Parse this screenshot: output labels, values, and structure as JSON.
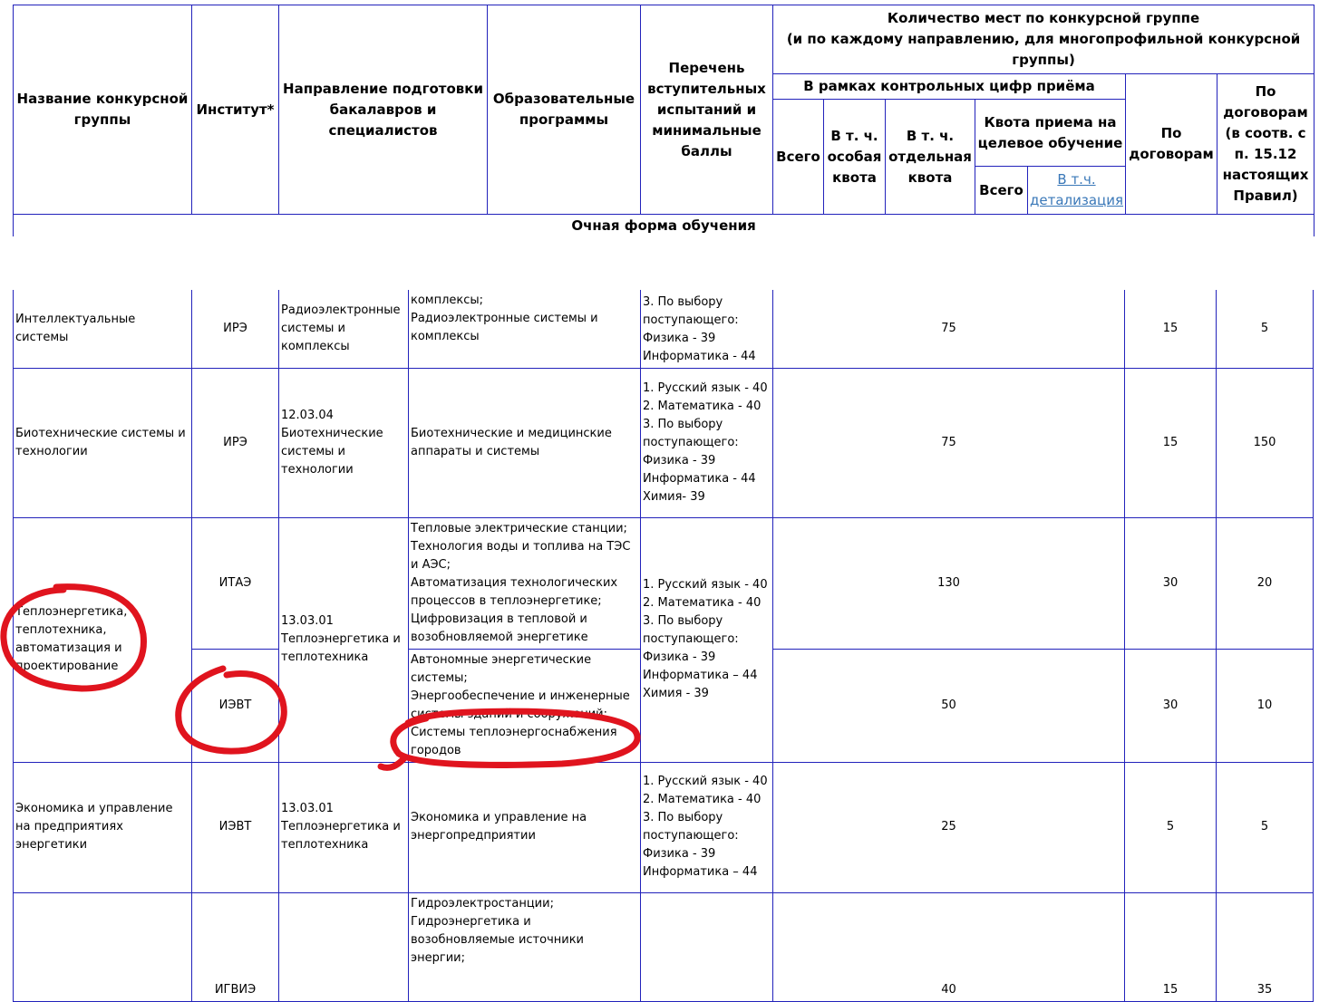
{
  "header": {
    "col_name": "Название конкурсной группы",
    "col_institute": "Институт*",
    "col_direction": "Направление подготовки бакалавров и специалистов",
    "col_programs": "Образовательные программы",
    "col_exams": "Перечень вступительных испытаний и минимальные баллы",
    "col_places": "Количество мест по конкурсной группе\n(и по каждому направлению, для многопрофильной конкурсной группы)",
    "col_control": "В рамках контрольных цифр приёма",
    "col_total": "Всего",
    "col_special": "В т. ч. особая квота",
    "col_separate": "В т. ч. отдельная квота",
    "col_target": "Квота приема на целевое обучение",
    "col_target_total": "Всего",
    "col_target_detail": "В т.ч. детализация",
    "col_contract": "По договорам",
    "col_contract_1512": "По договорам (в соотв. с п. 15.12 настоящих Правил)",
    "section_title": "Очная форма обучения"
  },
  "rows": {
    "r1": {
      "name": "Интеллектуальные системы",
      "institute": "ИРЭ",
      "direction": "Радиоэлектронные системы и комплексы",
      "programs": "комплексы;\nРадиоэлектронные системы и комплексы",
      "exams": "3. По выбору поступающего:\nФизика - 39\nИнформатика - 44",
      "total": "75",
      "contract": "15",
      "contract_1512": "5"
    },
    "r2": {
      "name": "Биотехнические системы и технологии",
      "institute": "ИРЭ",
      "direction": "12.03.04\nБиотехнические системы и технологии",
      "programs": "Биотехнические и медицинские аппараты и системы",
      "exams": "1. Русский язык - 40\n2. Математика - 40\n3. По выбору поступающего:\nФизика - 39\nИнформатика - 44\nХимия- 39",
      "total": "75",
      "contract": "15",
      "contract_1512": "150"
    },
    "r3": {
      "name": "Теплоэнергетика, теплотехника, автоматизация и проектирование",
      "direction": "13.03.01\nТеплоэнергетика и теплотехника",
      "exams": "1. Русский язык - 40\n2. Математика - 40\n3. По выбору поступающего:\nФизика - 39\nИнформатика – 44\nХимия - 39",
      "a": {
        "institute": "ИТАЭ",
        "programs": "Тепловые электрические станции;\nТехнология воды и топлива на ТЭС и АЭС;\nАвтоматизация технологических процессов в теплоэнергетике;\nЦифровизация в тепловой и возобновляемой энергетике",
        "total": "130",
        "contract": "30",
        "contract_1512": "20"
      },
      "b": {
        "institute": "ИЭВТ",
        "programs": "Автономные энергетические системы;\nЭнергообеспечение и инженерные системы зданий и сооружений;\nСистемы теплоэнергоснабжения городов",
        "total": "50",
        "contract": "30",
        "contract_1512": "10"
      }
    },
    "r4": {
      "name": "Экономика и управление на предприятиях энергетики",
      "institute": "ИЭВТ",
      "direction": "13.03.01\nТеплоэнергетика и теплотехника",
      "programs": "Экономика и управление на энергопредприятии",
      "exams": "1. Русский язык - 40\n2. Математика - 40\n3. По выбору поступающего:\nФизика - 39\nИнформатика – 44",
      "total": "25",
      "contract": "5",
      "contract_1512": "5"
    },
    "r5": {
      "institute": "ИГВИЭ",
      "programs": "Гидроэлектростанции;\nГидроэнергетика и возобновляемые источники энергии;",
      "total": "40",
      "contract": "15",
      "contract_1512": "35"
    }
  },
  "annotation_color": "#e0141e"
}
